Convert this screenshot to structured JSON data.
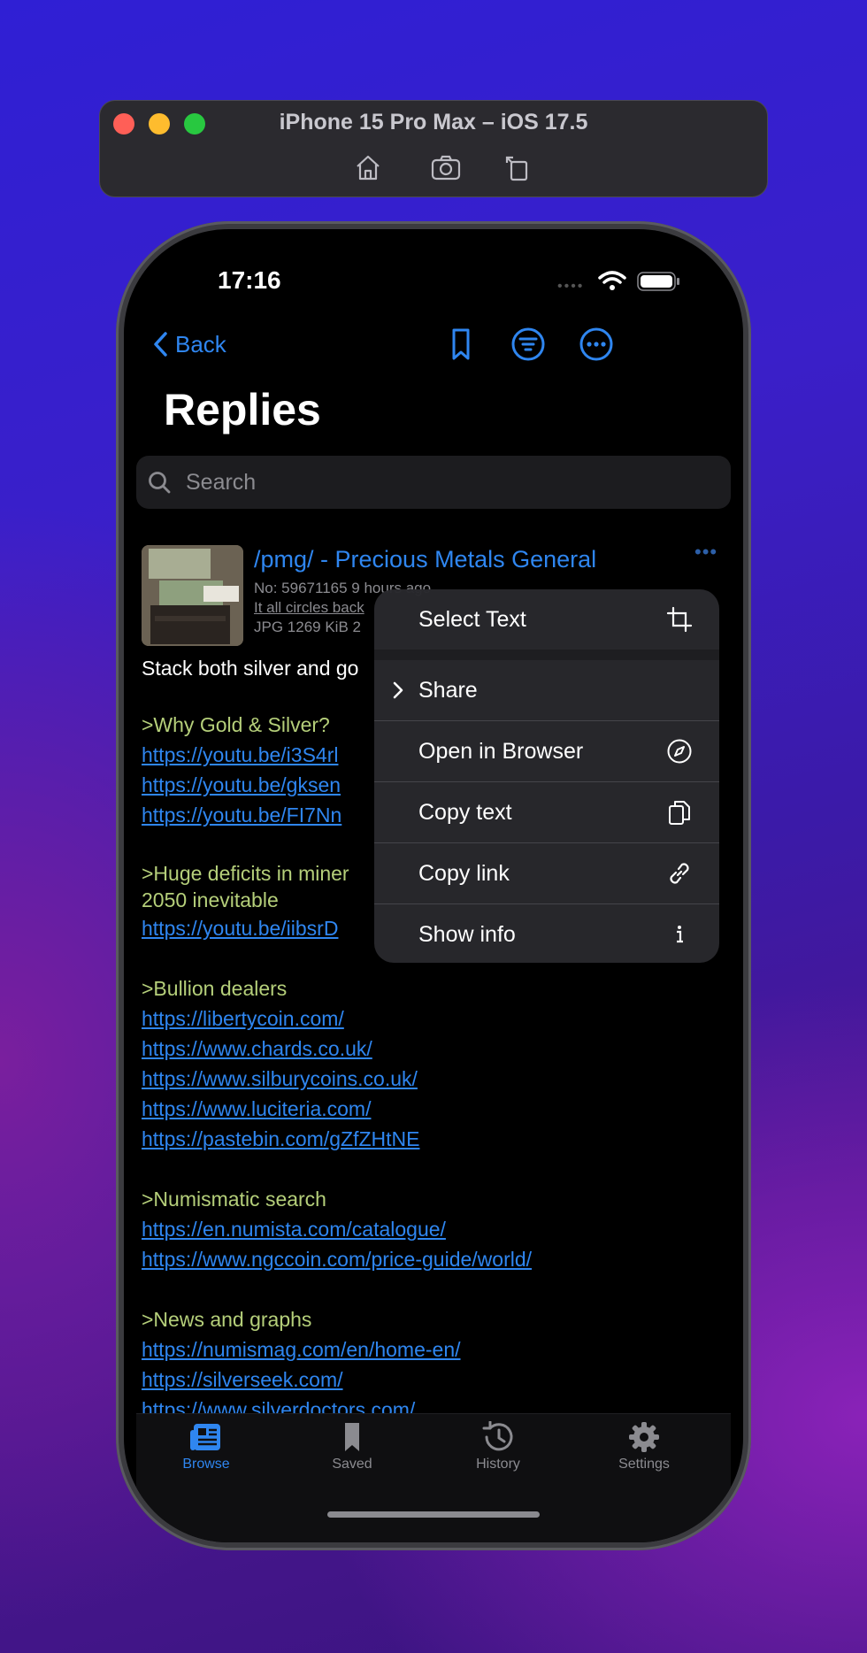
{
  "simulator": {
    "title": "iPhone 15 Pro Max – iOS 17.5",
    "tools": [
      "home-icon",
      "screenshot-icon",
      "rotate-icon"
    ]
  },
  "status_bar": {
    "time": "17:16"
  },
  "nav": {
    "back_label": "Back",
    "icons": [
      "bookmark-icon",
      "filter-icon",
      "more-icon"
    ]
  },
  "page": {
    "title": "Replies"
  },
  "search": {
    "placeholder": "Search"
  },
  "post": {
    "title": "/pmg/ - Precious Metals General",
    "meta_line1": "No: 59671165 9 hours ago",
    "meta_line2": "It all circles back",
    "meta_line3": "JPG 1269 KiB 2",
    "intro": "Stack both silver and go",
    "sections": [
      {
        "heading": ">Why Gold & Silver?",
        "links": [
          "https://youtu.be/i3S4rl",
          "https://youtu.be/gksen",
          "https://youtu.be/FI7Nn"
        ]
      },
      {
        "heading": ">Huge deficits in miner",
        "heading2": "2050 inevitable",
        "links": [
          "https://youtu.be/iibsrD"
        ]
      },
      {
        "heading": ">Bullion dealers",
        "links": [
          "https://libertycoin.com/",
          "https://www.chards.co.uk/",
          "https://www.silburycoins.co.uk/",
          "https://www.luciteria.com/",
          "https://pastebin.com/gZfZHtNE"
        ]
      },
      {
        "heading": ">Numismatic search",
        "links": [
          "https://en.numista.com/catalogue/",
          "https://www.ngccoin.com/price-guide/world/"
        ]
      },
      {
        "heading": ">News and graphs",
        "links": [
          "https://numismag.com/en/home-en/",
          "https://silverseek.com/",
          "https://www.silverdoctors.com/"
        ]
      }
    ]
  },
  "context_menu": {
    "select_text": "Select Text",
    "share": "Share",
    "open_browser": "Open in Browser",
    "copy_text": "Copy text",
    "copy_link": "Copy link",
    "show_info": "Show info"
  },
  "tabbar": {
    "items": [
      {
        "label": "Browse",
        "active": true
      },
      {
        "label": "Saved",
        "active": false
      },
      {
        "label": "History",
        "active": false
      },
      {
        "label": "Settings",
        "active": false
      }
    ],
    "active_color": "#2f86f0",
    "inactive_color": "#8b8b90"
  }
}
